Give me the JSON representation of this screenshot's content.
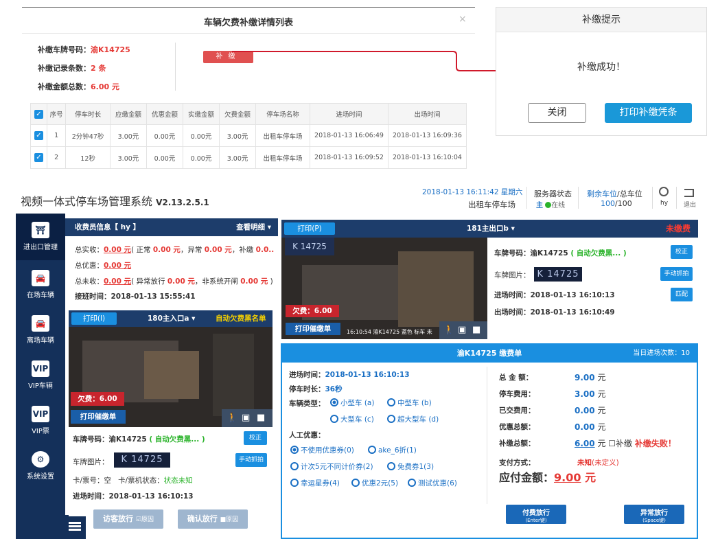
{
  "modal": {
    "title": "车辆欠费补缴详情列表",
    "close": "×",
    "plate_label": "补缴车牌号码：",
    "plate_value": "渝K14725",
    "count_label": "补缴记录条数：",
    "count_value": "2 条",
    "total_label": "补缴金额总数：",
    "total_value": "6.00 元",
    "pay_button": "补缴",
    "columns": [
      "序号",
      "停车时长",
      "应缴金额",
      "优惠金额",
      "实缴金额",
      "欠费金额",
      "停车场名称",
      "进场时间",
      "出场时间"
    ],
    "rows": [
      [
        "1",
        "2分钟47秒",
        "3.00元",
        "0.00元",
        "0.00元",
        "3.00元",
        "出租车停车场",
        "2018-01-13 16:06:49",
        "2018-01-13 16:09:36"
      ],
      [
        "2",
        "12秒",
        "3.00元",
        "0.00元",
        "0.00元",
        "3.00元",
        "出租车停车场",
        "2018-01-13 16:09:52",
        "2018-01-13 16:10:04"
      ]
    ]
  },
  "prompt": {
    "title": "补缴提示",
    "message": "补缴成功！",
    "close_button": "关闭",
    "print_button": "打印补缴凭条"
  },
  "header": {
    "app_name": "视频一体式停车场管理系统",
    "version": "V2.13.2.5.1",
    "datetime": "2018-01-13 16:11:42 星期六",
    "lot_name": "出租车停车场",
    "server_status_label": "服务器状态",
    "server_main": "主",
    "server_online": "在线",
    "spaces_label_remaining": "剩余车位",
    "spaces_label_total": "/总车位",
    "spaces_remaining": "100",
    "spaces_total": "/100",
    "user": "hy",
    "logout": "退出"
  },
  "sidebar": {
    "items": [
      {
        "label": "进出口管理",
        "icon": "gate-icon"
      },
      {
        "label": "在场车辆",
        "icon": "car-icon"
      },
      {
        "label": "离场车辆",
        "icon": "car-exit-icon"
      },
      {
        "label": "VIP车辆",
        "icon": "vip-icon"
      },
      {
        "label": "VIP票",
        "icon": "vip-ticket-icon"
      },
      {
        "label": "系统设置",
        "icon": "gear-icon"
      }
    ]
  },
  "cashier": {
    "title": "收费员信息【 hy 】",
    "more": "查看明细 ▾",
    "line1_a": "总实收：",
    "line1_total": "0.00 元",
    "line1_b": "( 正常 ",
    "line1_normal": "0.00 元",
    "line1_c": "，异常 ",
    "line1_abnormal": "0.00 元",
    "line1_d": "，补缴 ",
    "line1_supp": "0.0...",
    "line2_a": "总优惠：",
    "line2_val": "0.00 元",
    "line3_a": "总未收：",
    "line3_val": "0.00 元",
    "line3_b": "( 异常放行 ",
    "line3_v2": "0.00 元",
    "line3_c": "，非系统开闸 ",
    "line3_v3": "0.00 元",
    "line3_d": " )",
    "shift_label": "接班时间：",
    "shift_value": "2018-01-13 15:55:41"
  },
  "entry": {
    "print": "打印(I)",
    "gate": "180主入口a ▾",
    "status": "自动欠费黑名单",
    "fee": "欠费：6.00",
    "urge": "打印催缴单",
    "plate_label": "车牌号码：",
    "plate_value": "渝K14725",
    "plate_note": "( 自动欠费黑... )",
    "verify": "校正",
    "pic_label": "车牌图片：",
    "pic_text": "K 14725",
    "snap": "手动抓拍",
    "card_label": "卡/票号：空",
    "card_status_label": "卡/票机状态：",
    "card_status": "状态未知",
    "in_label": "进场时间：",
    "in_time": "2018-01-13 16:10:13",
    "visitor_btn": "访客放行",
    "confirm_btn": "确认放行",
    "reason": "原因"
  },
  "exit": {
    "print": "打印(P)",
    "gate": "181主出口b ▾",
    "status": "未缴费",
    "fee": "欠费：6.00",
    "urge": "打印催缴单",
    "cam_caption": "16:10:54 渝K14725 蓝色 标车 未",
    "plate_label": "车牌号码：",
    "plate_value": "渝K14725",
    "plate_note": "( 自动欠费黑... )",
    "verify": "校正",
    "pic_label": "车牌图片：",
    "pic_text": "K 14725",
    "snap": "手动抓拍",
    "in_label": "进场时间：",
    "in_time": "2018-01-13 16:10:13",
    "match": "匹配",
    "out_label": "出场时间：",
    "out_time": "2018-01-13 16:10:49"
  },
  "payment": {
    "title": "渝K14725 缴费单",
    "day_count_label": "当日进场次数：",
    "day_count": "10",
    "in_label": "进场时间：",
    "in_time": "2018-01-13 16:10:13",
    "dur_label": "停车时长：",
    "dur_value": "36秒",
    "type_label": "车辆类型：",
    "types": [
      "小型车 (a)",
      "中型车 (b)",
      "大型车 (c)",
      "超大型车 (d)"
    ],
    "discount_label": "人工优惠：",
    "coupons": [
      "不使用优惠券(0)",
      "ake_6折(1)",
      "计次5元不同计价券(2)",
      "免费券1(3)",
      "幸运星券(4)",
      "优惠2元(5)",
      "测试优惠(6)"
    ],
    "total_label": "总 金 额：",
    "total": "9.00",
    "fee_label": "停车费用：",
    "fee": "3.00",
    "paid_label": "已交费用：",
    "paid": "0.00",
    "disc_label": "优惠总额：",
    "disc": "0.00",
    "supp_label": "补缴总额：",
    "supp": "6.00",
    "unit": "元",
    "supp_check": "补缴",
    "supp_fail": "补缴失败！",
    "method_label": "支付方式：",
    "method": "未知",
    "method_note": "(未定义)",
    "due_label": "应付金额：",
    "due": "9.00",
    "due_unit": "元",
    "pay_btn": "付费放行",
    "pay_key": "(Enter键)",
    "abn_btn": "异常放行",
    "abn_key": "(Space键)"
  },
  "colors": {
    "accent": "#1a8fe0",
    "navy": "#14305a",
    "alert": "#e53935"
  }
}
